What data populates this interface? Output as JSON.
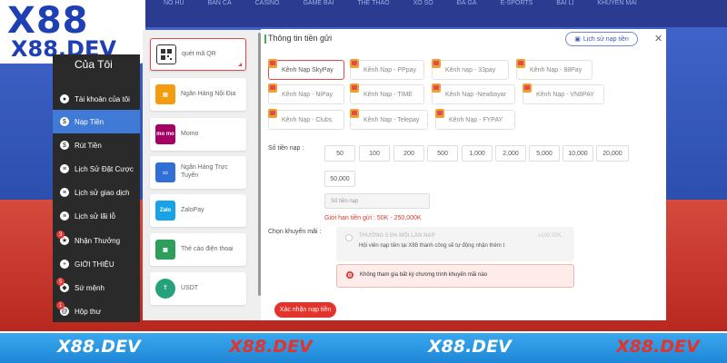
{
  "background": {
    "nav": [
      "NỔ HŨ",
      "BẮN CÁ",
      "CASINO",
      "GAME BÀI",
      "THỂ THAO",
      "XỔ SỐ",
      "ĐÁ GÀ",
      "E-SPORTS",
      "BÀI LỊ",
      "KHUYẾN MÃI"
    ]
  },
  "logo": {
    "main": "X88",
    "sub": "X88.DEV"
  },
  "sidebar": {
    "title": "Của Tôi",
    "items": [
      {
        "label": "Tài khoản của tôi",
        "icon": "user-icon",
        "badge": ""
      },
      {
        "label": "Nạp Tiền",
        "icon": "deposit-icon",
        "badge": ""
      },
      {
        "label": "Rút Tiền",
        "icon": "withdraw-icon",
        "badge": ""
      },
      {
        "label": "Lịch Sử Đặt Cược",
        "icon": "bet-history-icon",
        "badge": ""
      },
      {
        "label": "Lịch sử giao dịch",
        "icon": "transaction-icon",
        "badge": ""
      },
      {
        "label": "Lịch sử lãi lỗ",
        "icon": "profit-loss-icon",
        "badge": ""
      },
      {
        "label": "Nhận Thưởng",
        "icon": "reward-icon",
        "badge": "3"
      },
      {
        "label": "GIỚI THIỆU",
        "icon": "referral-icon",
        "badge": ""
      },
      {
        "label": "Sứ mệnh",
        "icon": "mission-icon",
        "badge": "5"
      },
      {
        "label": "Hộp thư",
        "icon": "mail-icon",
        "badge": "1"
      }
    ]
  },
  "methods": [
    {
      "label": "quét mã QR",
      "icon": "qr-icon",
      "color": "#333333"
    },
    {
      "label": "Ngân Hàng Nội Địa",
      "icon": "bank-icon",
      "color": "#f39c12"
    },
    {
      "label": "Momo",
      "icon": "momo-icon",
      "color": "#a50064",
      "icon_text": "mo mo"
    },
    {
      "label": "Ngân Hàng Trực Tuyến",
      "icon": "online-bank-icon",
      "color": "#2f6fd6"
    },
    {
      "label": "ZaloPay",
      "icon": "zalopay-icon",
      "color": "#1aa2e6",
      "icon_text": "Zalo"
    },
    {
      "label": "Thẻ cào điện thoại",
      "icon": "phone-card-icon",
      "color": "#2e9e5b"
    },
    {
      "label": "USDT",
      "icon": "usdt-icon",
      "color": "#26a17b"
    }
  ],
  "main": {
    "title": "Thông tin tiền gửi",
    "history_label": "Lịch sử nạp tiền",
    "channels": [
      "Kênh Nạp SkyPay",
      "Kênh Nạp - PPpay",
      "Kênh nạp - 33pay",
      "Kênh Nạp - 88Pay",
      "Kênh Nạp - NiPay",
      "Kênh Nạp - TIME",
      "Kênh Nạp -Newbayar",
      "Kênh Nạp - VN8PAY",
      "Kênh Nạp - Clubs",
      "Kênh Nạp - Telepay",
      "Kênh Nạp - FYPAY"
    ],
    "amount_label": "Số tiền nạp :",
    "amounts": [
      "50",
      "100",
      "200",
      "500",
      "1,000",
      "2,000",
      "5,000",
      "10,000",
      "20,000",
      "50,000"
    ],
    "amount_placeholder": "Số tiền nạp",
    "limit_text": "Giới hạn tiền gửi :  50K  - 250,000K",
    "promo_label": "Chọn khuyến mãi :",
    "promo_option1_title": "THƯỞNG 0.5% MỖI LẦN NẠP",
    "promo_option1_value": "≥100.00K",
    "promo_option1_desc": "Hội viên nạp tiền tại X88 thành công sẽ tự động nhận thêm t",
    "promo_option2": "Không tham gia bất kỳ chương trình khuyến mãi nào",
    "confirm_label": "Xác nhận nạp tiền"
  },
  "footer": {
    "brands": [
      "X88.DEV",
      "X88.DEV",
      "X88.DEV",
      "X88.DEV"
    ]
  },
  "colors": {
    "accent_red": "#e4332a",
    "active_blue": "#3f7ad6",
    "footer_blue": "#1e86d6"
  }
}
